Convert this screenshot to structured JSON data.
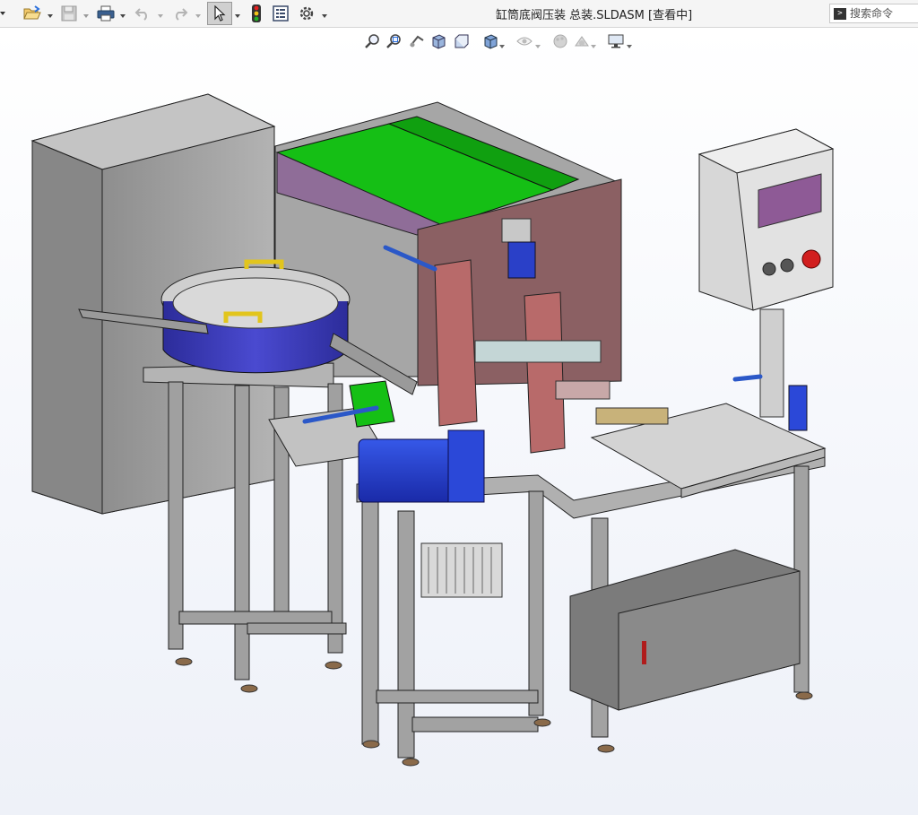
{
  "window": {
    "title": "缸筒底阀压装 总装.SLDASM [查看中]"
  },
  "search": {
    "placeholder": "搜索命令",
    "prompt_glyph": ">"
  },
  "toolbar": {
    "buttons": [
      "new-icon",
      "open-icon",
      "save-icon",
      "print-icon",
      "undo-icon",
      "redo-icon",
      "select-icon",
      "rebuild-icon",
      "file-properties-icon",
      "options-icon"
    ]
  },
  "view_toolbar": {
    "buttons": [
      "zoom-to-fit-icon",
      "zoom-to-area-icon",
      "previous-view-icon",
      "section-view-icon",
      "view-orientation-icon",
      "display-style-icon",
      "hide-show-items-icon",
      "edit-appearance-icon",
      "apply-scene-icon",
      "view-settings-icon"
    ]
  },
  "colors": {
    "accent_red": "#d11e1e",
    "accent_blue": "#2b58c8",
    "frame_gray": "#9e9e9e",
    "green_panel": "#17c317",
    "enclosure_mauve": "#8a5f63"
  }
}
